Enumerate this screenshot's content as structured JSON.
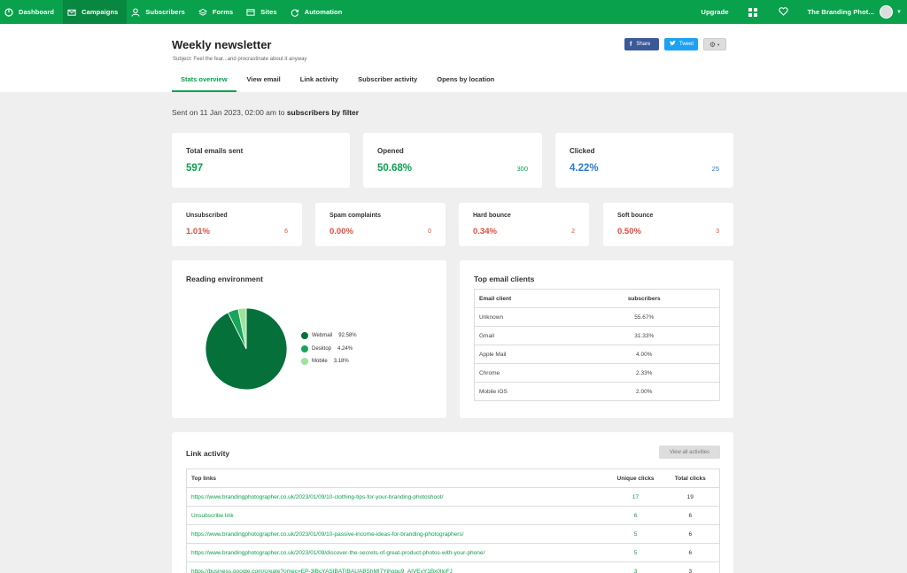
{
  "nav": {
    "items": [
      {
        "label": "Dashboard",
        "icon": "dashboard-icon"
      },
      {
        "label": "Campaigns",
        "icon": "mail-icon"
      },
      {
        "label": "Subscribers",
        "icon": "user-icon"
      },
      {
        "label": "Forms",
        "icon": "layers-icon"
      },
      {
        "label": "Sites",
        "icon": "browser-icon"
      },
      {
        "label": "Automation",
        "icon": "refresh-icon"
      }
    ],
    "upgrade": "Upgrade",
    "account": "The Branding Phot..."
  },
  "header": {
    "title": "Weekly newsletter",
    "subject": "Subject: Feel the fear...and procrastinate about it anyway",
    "share_label": "Share",
    "tweet_label": "Tweet"
  },
  "tabs": [
    "Stats overview",
    "View email",
    "Link activity",
    "Subscriber activity",
    "Opens by location"
  ],
  "sent": {
    "prefix": "Sent on 11 Jan 2023, 02:00 am to ",
    "target": "subscribers by filter"
  },
  "stats": {
    "total": {
      "label": "Total emails sent",
      "value": "597"
    },
    "opened": {
      "label": "Opened",
      "value": "50.68%",
      "count": "300"
    },
    "clicked": {
      "label": "Clicked",
      "value": "4.22%",
      "count": "25"
    },
    "unsubscribed": {
      "label": "Unsubscribed",
      "value": "1.01%",
      "count": "6"
    },
    "spam": {
      "label": "Spam complaints",
      "value": "0.00%",
      "count": "0"
    },
    "hard": {
      "label": "Hard bounce",
      "value": "0.34%",
      "count": "2"
    },
    "soft": {
      "label": "Soft bounce",
      "value": "0.50%",
      "count": "3"
    }
  },
  "reading": {
    "title": "Reading environment",
    "legend": [
      {
        "label": "Webmail",
        "pct": "92.58%"
      },
      {
        "label": "Desktop",
        "pct": "4.24%"
      },
      {
        "label": "Mobile",
        "pct": "3.18%"
      }
    ]
  },
  "chart_data": {
    "type": "pie",
    "categories": [
      "Webmail",
      "Desktop",
      "Mobile"
    ],
    "values": [
      92.58,
      4.24,
      3.18
    ],
    "colors": [
      "#05703a",
      "#16a55a",
      "#9de39b"
    ],
    "legend_position": "right"
  },
  "clients": {
    "title": "Top email clients",
    "headers": [
      "Email client",
      "subscribers"
    ],
    "rows": [
      [
        "Unknown",
        "55.67%"
      ],
      [
        "Gmail",
        "31.33%"
      ],
      [
        "Apple Mail",
        "4.00%"
      ],
      [
        "Chrome",
        "2.33%"
      ],
      [
        "Mobile iOS",
        "2.00%"
      ]
    ]
  },
  "links": {
    "title": "Link activity",
    "view_all": "View all activities",
    "headers": [
      "Top links",
      "Unique clicks",
      "Total clicks"
    ],
    "rows": [
      [
        "https://www.brandingphotographer.co.uk/2023/01/09/10-clothing-tips-for-your-branding-photoshoot/",
        "17",
        "19"
      ],
      [
        "Unsubscribe link",
        "6",
        "6"
      ],
      [
        "https://www.brandingphotographer.co.uk/2023/01/09/10-passive-income-ideas-for-branding-photographers/",
        "5",
        "6"
      ],
      [
        "https://www.brandingphotographer.co.uk/2023/01/09/discover-the-secrets-of-great-product-photos-with-your-phone/",
        "5",
        "6"
      ],
      [
        "https://business.google.com/create?omec=EP-3lBcYASIBATIBAUABShMI7Yjhopu9_AIVEvY1Bx0lloFJ",
        "3",
        "3"
      ]
    ]
  },
  "colors": {
    "brand": "#09a14c",
    "blue": "#2c7bd3",
    "red": "#e74c3c"
  }
}
